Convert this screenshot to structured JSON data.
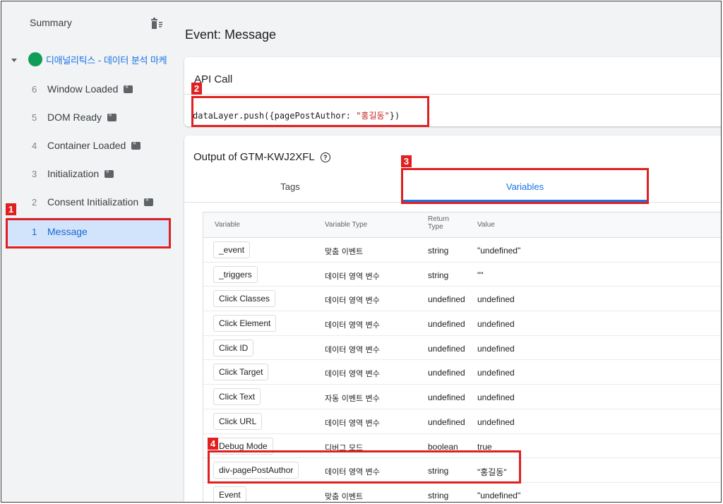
{
  "sidebar": {
    "summary_label": "Summary",
    "root_label": "디애널리틱스 - 데이터 분석 마케",
    "items": [
      {
        "num": "6",
        "label": "Window Loaded"
      },
      {
        "num": "5",
        "label": "DOM Ready"
      },
      {
        "num": "4",
        "label": "Container Loaded"
      },
      {
        "num": "3",
        "label": "Initialization"
      },
      {
        "num": "2",
        "label": "Consent Initialization"
      },
      {
        "num": "1",
        "label": "Message"
      }
    ]
  },
  "main": {
    "title": "Event: Message",
    "api": {
      "title": "API Call",
      "code_prefix": "dataLayer.push({pagePostAuthor: ",
      "code_string": "\"홍길동\"",
      "code_suffix": "})"
    },
    "output": {
      "title": "Output of GTM-KWJ2XFL",
      "tabs": [
        "Tags",
        "Variables"
      ],
      "active_tab": "Variables",
      "columns": {
        "variable": "Variable",
        "type": "Variable Type",
        "return_type": "Return Type",
        "value": "Value"
      },
      "rows": [
        {
          "name": "_event",
          "type": "맞춤 이벤트",
          "ret": "string",
          "value": "\"undefined\""
        },
        {
          "name": "_triggers",
          "type": "데이터 영역 변수",
          "ret": "string",
          "value": "\"\""
        },
        {
          "name": "Click Classes",
          "type": "데이터 영역 변수",
          "ret": "undefined",
          "value": "undefined"
        },
        {
          "name": "Click Element",
          "type": "데이터 영역 변수",
          "ret": "undefined",
          "value": "undefined"
        },
        {
          "name": "Click ID",
          "type": "데이터 영역 변수",
          "ret": "undefined",
          "value": "undefined"
        },
        {
          "name": "Click Target",
          "type": "데이터 영역 변수",
          "ret": "undefined",
          "value": "undefined"
        },
        {
          "name": "Click Text",
          "type": "자동 이벤트 변수",
          "ret": "undefined",
          "value": "undefined"
        },
        {
          "name": "Click URL",
          "type": "데이터 영역 변수",
          "ret": "undefined",
          "value": "undefined"
        },
        {
          "name": "Debug Mode",
          "type": "디버그 모드",
          "ret": "boolean",
          "value": "true"
        },
        {
          "name": "div-pagePostAuthor",
          "type": "데이터 영역 변수",
          "ret": "string",
          "value": "\"홍길동\""
        },
        {
          "name": "Event",
          "type": "맞춤 이벤트",
          "ret": "string",
          "value": "\"undefined\""
        }
      ]
    }
  },
  "annotations": [
    "1",
    "2",
    "3",
    "4"
  ],
  "colors": {
    "accent": "#1a73e8",
    "annotation": "#e02020",
    "active_bg": "#d2e3fc",
    "status_green": "#0f9d58"
  }
}
